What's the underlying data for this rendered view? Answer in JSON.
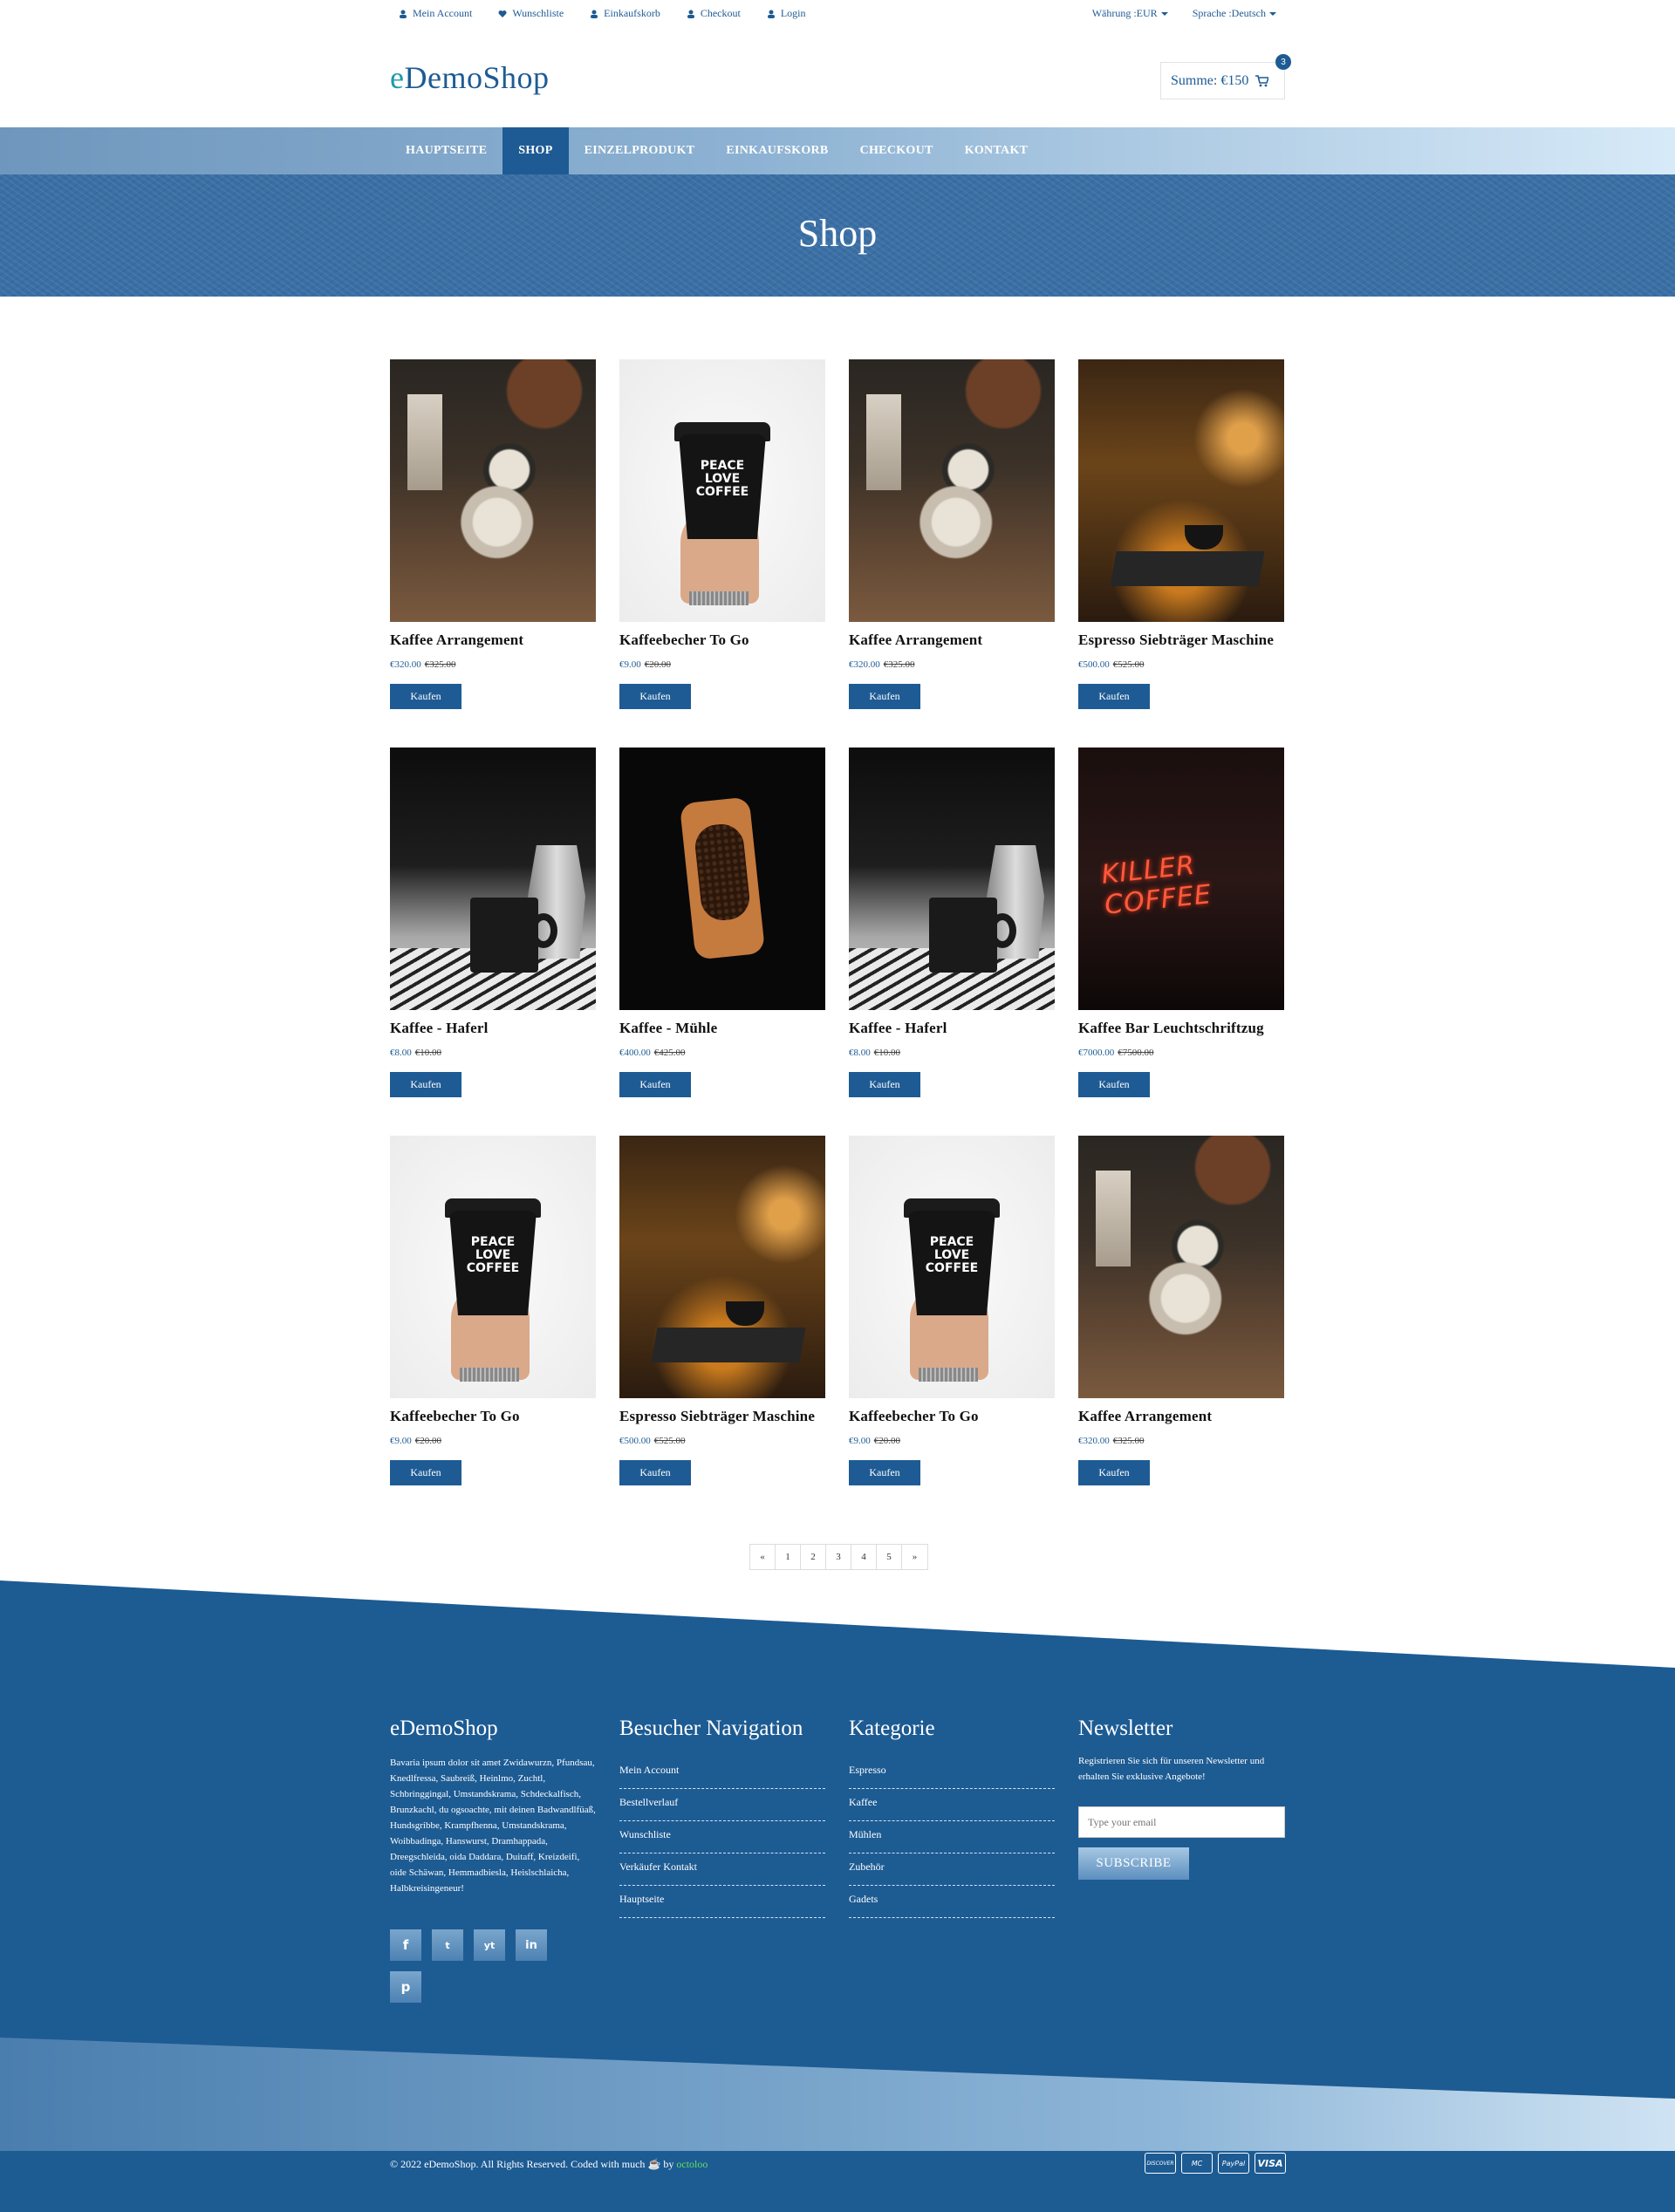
{
  "topbar": {
    "links": [
      "Mein Account",
      "Wunschliste",
      "Einkaufskorb",
      "Checkout",
      "Login"
    ],
    "currency": "Währung :EUR",
    "language": "Sprache :Deutsch"
  },
  "header": {
    "logo_prefix": "e",
    "logo_rest": "DemoShop",
    "cart_label": "Summe: €150",
    "cart_count": "3"
  },
  "nav": {
    "items": [
      "HAUPTSEITE",
      "SHOP",
      "EINZELPRODUKT",
      "EINKAUFSKORB",
      "CHECKOUT",
      "KONTAKT"
    ],
    "active": "SHOP"
  },
  "banner": {
    "title": "Shop"
  },
  "products": [
    {
      "name": "Kaffee Arrangement",
      "price": "€320.00",
      "old_price": "€325.00",
      "button": "Kaufen",
      "image": "arrangement"
    },
    {
      "name": "Kaffeebecher To Go",
      "price": "€9.00",
      "old_price": "€20.00",
      "button": "Kaufen",
      "image": "cup"
    },
    {
      "name": "Kaffee Arrangement",
      "price": "€320.00",
      "old_price": "€325.00",
      "button": "Kaufen",
      "image": "arrangement"
    },
    {
      "name": "Espresso Siebträger Maschine",
      "price": "€500.00",
      "old_price": "€525.00",
      "button": "Kaufen",
      "image": "espresso"
    },
    {
      "name": "Kaffee - Haferl",
      "price": "€8.00",
      "old_price": "€10.00",
      "button": "Kaufen",
      "image": "mug"
    },
    {
      "name": "Kaffee - Mühle",
      "price": "€400.00",
      "old_price": "€425.00",
      "button": "Kaufen",
      "image": "mill"
    },
    {
      "name": "Kaffee - Haferl",
      "price": "€8.00",
      "old_price": "€10.00",
      "button": "Kaufen",
      "image": "mug"
    },
    {
      "name": "Kaffee Bar Leuchtschriftzug",
      "price": "€7000.00",
      "old_price": "€7500.00",
      "button": "Kaufen",
      "image": "neon"
    },
    {
      "name": "Kaffeebecher To Go",
      "price": "€9.00",
      "old_price": "€20.00",
      "button": "Kaufen",
      "image": "cup"
    },
    {
      "name": "Espresso Siebträger Maschine",
      "price": "€500.00",
      "old_price": "€525.00",
      "button": "Kaufen",
      "image": "espresso"
    },
    {
      "name": "Kaffeebecher To Go",
      "price": "€9.00",
      "old_price": "€20.00",
      "button": "Kaufen",
      "image": "cup"
    },
    {
      "name": "Kaffee Arrangement",
      "price": "€320.00",
      "old_price": "€325.00",
      "button": "Kaufen",
      "image": "arrangement"
    }
  ],
  "image_text": {
    "cup_line1": "PEACE",
    "cup_line2": "LOVE",
    "cup_line3": "COFFEE",
    "neon": "KILLER COFFEE"
  },
  "pagination": [
    "«",
    "1",
    "2",
    "3",
    "4",
    "5",
    "»"
  ],
  "footer": {
    "about_title": "eDemoShop",
    "about_text": "Bavaria ipsum dolor sit amet Zwidawurzn, Pfundsau, Knedlfressa, Saubreiß, Heinlmo, Zuchtl, Schbringgingal, Umstandskrama, Schdeckalfisch, Brunzkachl, du ogsoachte, mit deinen Badwandlfüaß, Hundsgribbe, Krampfhenna, Umstandskrama, Woibbadinga, Hanswurst, Dramhappada, Dreegschleida, oida Daddara, Duitaff, Kreizdeifi, oide Schäwan, Hemmadbiesla, Heislschlaicha, Halbkreisingeneur!",
    "social": [
      "f",
      "t",
      "yt",
      "in",
      "p"
    ],
    "nav_title": "Besucher Navigation",
    "nav_links": [
      "Mein Account",
      "Bestellverlauf",
      "Wunschliste",
      "Verkäufer Kontakt",
      "Hauptseite"
    ],
    "cat_title": "Kategorie",
    "cat_links": [
      "Espresso",
      "Kaffee",
      "Mühlen",
      "Zubehör",
      "Gadets"
    ],
    "news_title": "Newsletter",
    "news_text": "Registrieren Sie sich für unseren Newsletter und erhalten Sie exklusive Angebote!",
    "email_placeholder": "Type your email",
    "subscribe_label": "SUBSCRIBE",
    "copyright": "© 2022 eDemoShop. All Rights Reserved. Coded with much",
    "by_word": "by",
    "author": "octoloo",
    "payments": [
      "DISCOVER",
      "MC",
      "PayPal",
      "VISA"
    ]
  },
  "colors": {
    "primary": "#1e5b94",
    "accent": "#1e9aa8",
    "author_link": "#5fe05f"
  }
}
